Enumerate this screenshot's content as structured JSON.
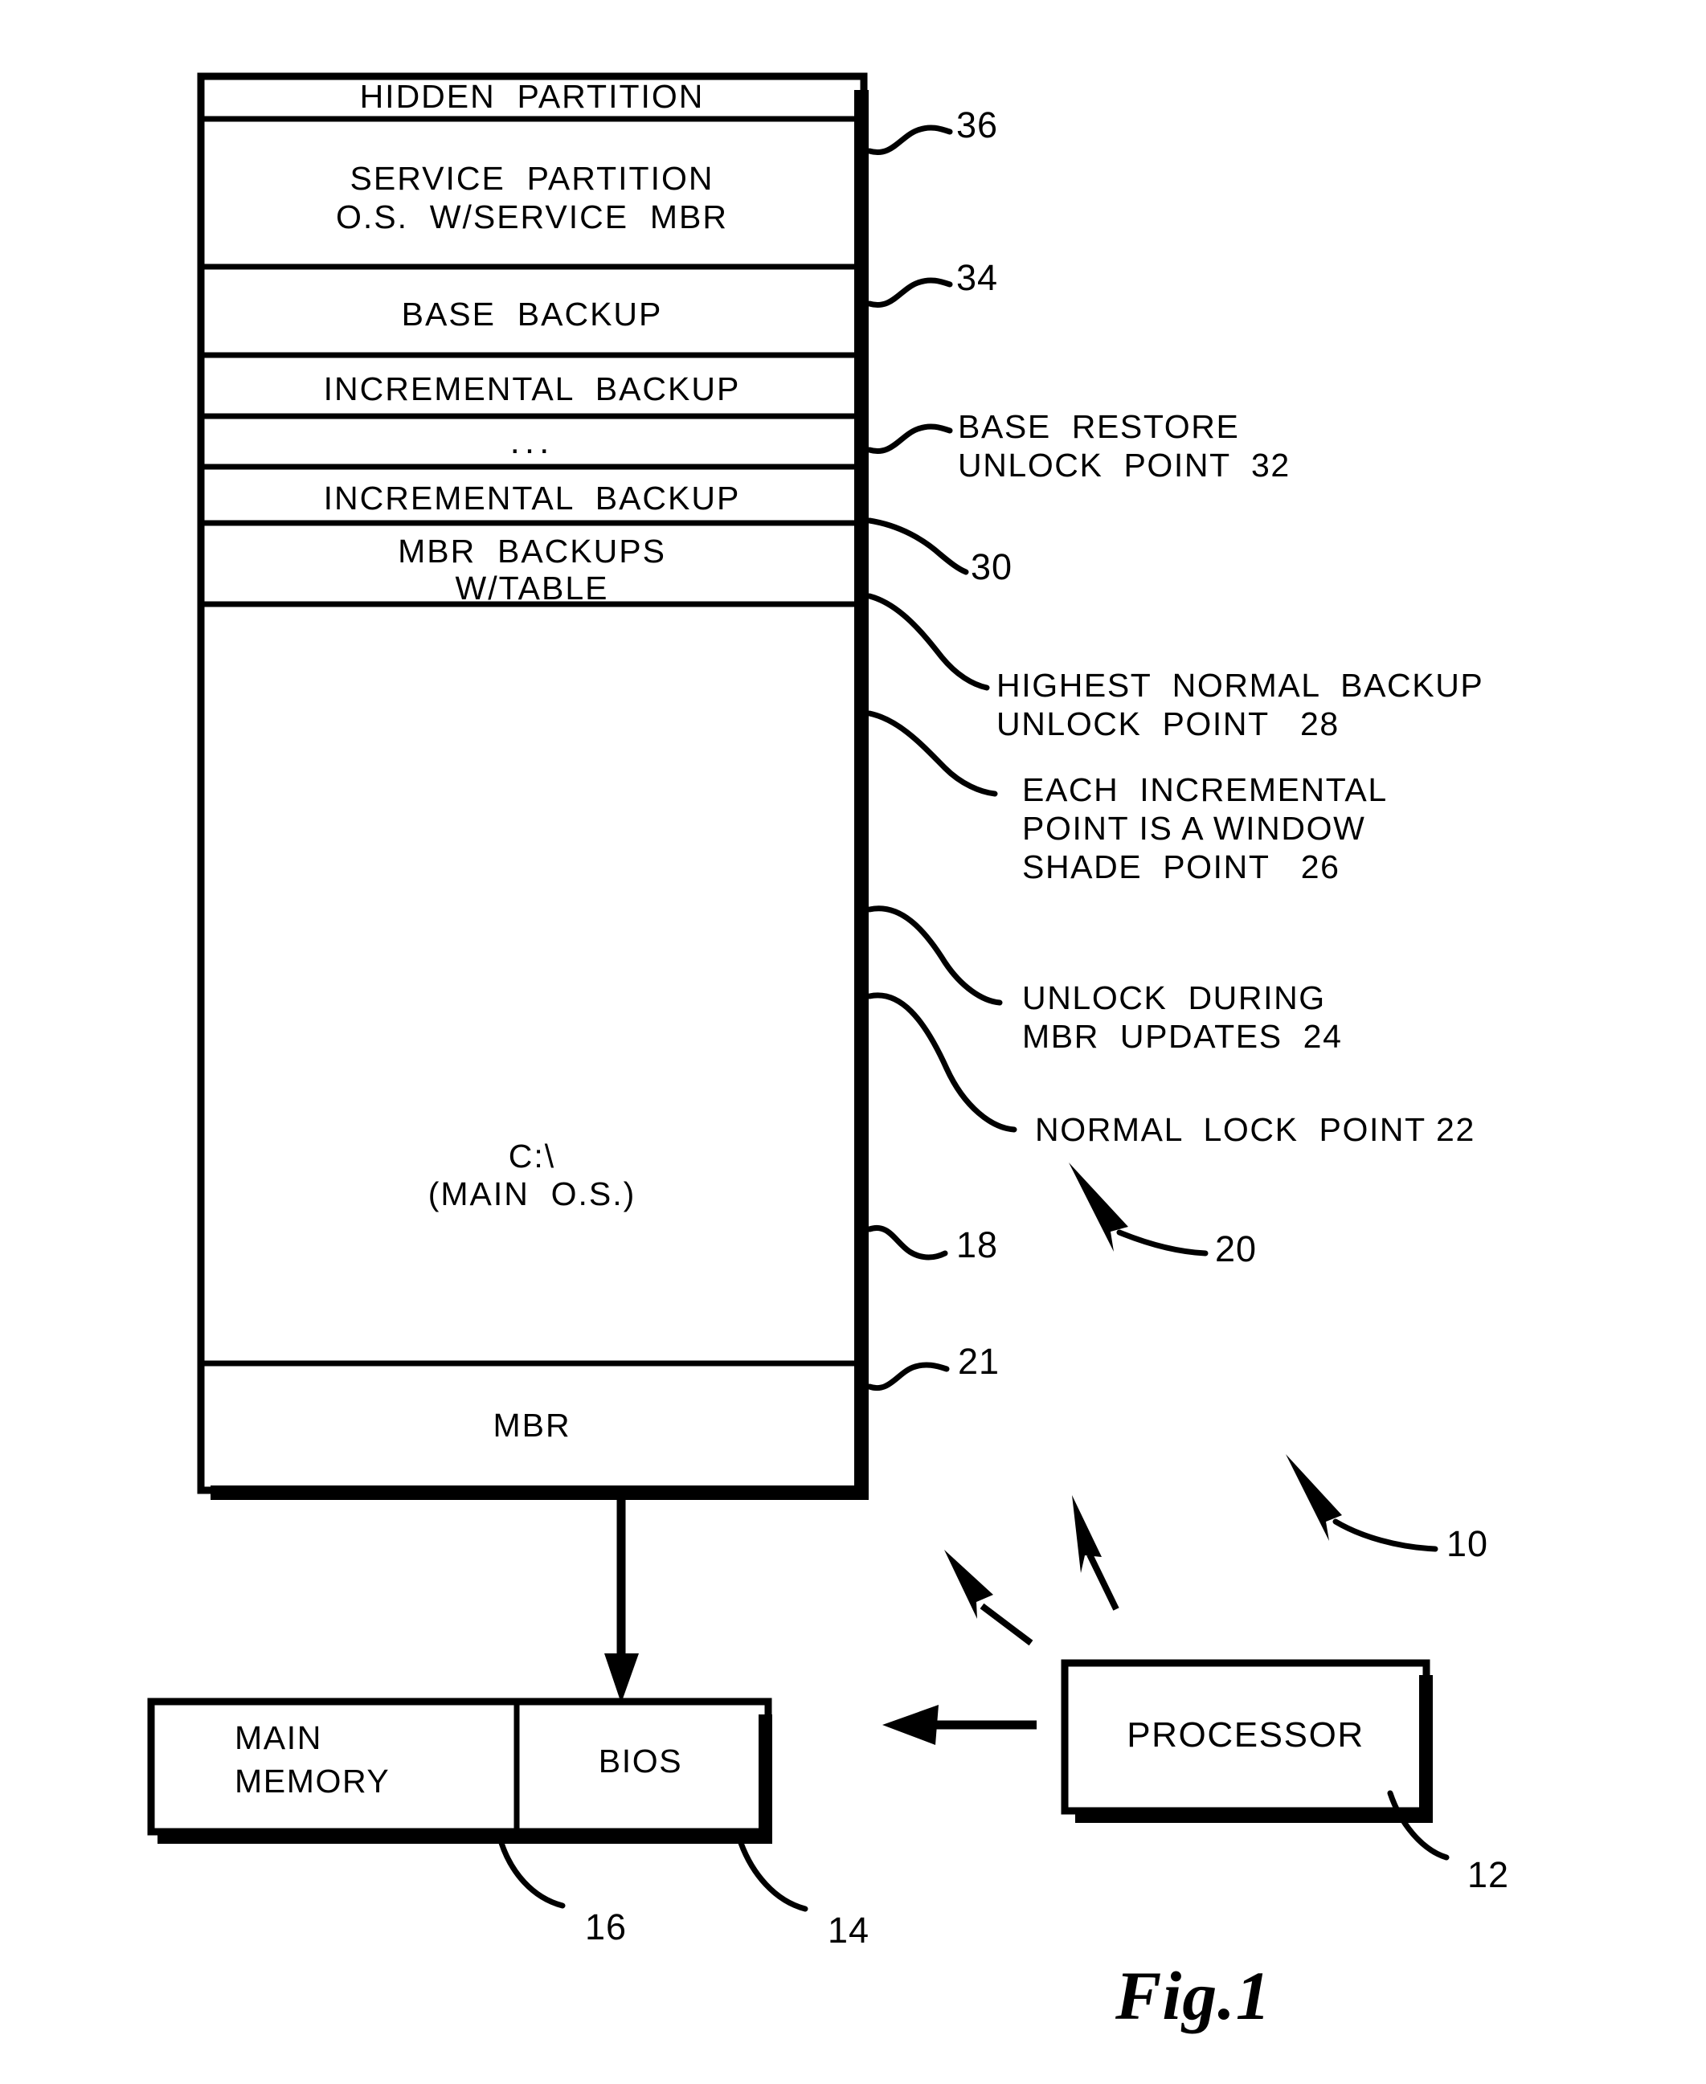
{
  "figure": {
    "caption": "Fig.1"
  },
  "disk_map": {
    "rows": [
      {
        "id": "hidden-partition",
        "label": "HIDDEN  PARTITION"
      },
      {
        "id": "service-partition",
        "label_line1": "SERVICE  PARTITION",
        "label_line2": "O.S.  W/SERVICE  MBR"
      },
      {
        "id": "base-backup",
        "label": "BASE  BACKUP"
      },
      {
        "id": "incremental-backup-top",
        "label": "INCREMENTAL  BACKUP"
      },
      {
        "id": "ellipsis",
        "label": "..."
      },
      {
        "id": "incremental-backup-bottom",
        "label": "INCREMENTAL  BACKUP"
      },
      {
        "id": "mbr-backups",
        "label_line1": "MBR  BACKUPS",
        "label_line2": "W/TABLE"
      },
      {
        "id": "main-os",
        "label_line1": "C:\\",
        "label_line2": "(MAIN  O.S.)"
      },
      {
        "id": "mbr",
        "label": "MBR"
      }
    ]
  },
  "callouts": {
    "hidden_partition_ref": "36",
    "service_partition_ref": "34",
    "base_restore_line1": "BASE  RESTORE",
    "base_restore_line2": "UNLOCK  POINT  32",
    "base_backup_ref": "30",
    "highest_normal_line1": "HIGHEST  NORMAL  BACKUP",
    "highest_normal_line2": "UNLOCK  POINT   28",
    "each_incremental_line1": "EACH  INCREMENTAL",
    "each_incremental_line2": "POINT IS A WINDOW",
    "each_incremental_line3": "SHADE  POINT   26",
    "unlock_mbr_line1": "UNLOCK  DURING",
    "unlock_mbr_line2": "MBR  UPDATES  24",
    "normal_lock_point": "NORMAL  LOCK  POINT 22",
    "main_os_ref": "18",
    "system_ref_20": "20",
    "mbr_ref": "21",
    "system_ref_10": "10"
  },
  "hardware": {
    "main_memory_line1": "MAIN",
    "main_memory_line2": "MEMORY",
    "main_memory_ref": "16",
    "bios_label": "BIOS",
    "bios_ref": "14",
    "processor_label": "PROCESSOR",
    "processor_ref": "12"
  },
  "colors": {
    "ink": "#000000",
    "paper": "#ffffff"
  }
}
